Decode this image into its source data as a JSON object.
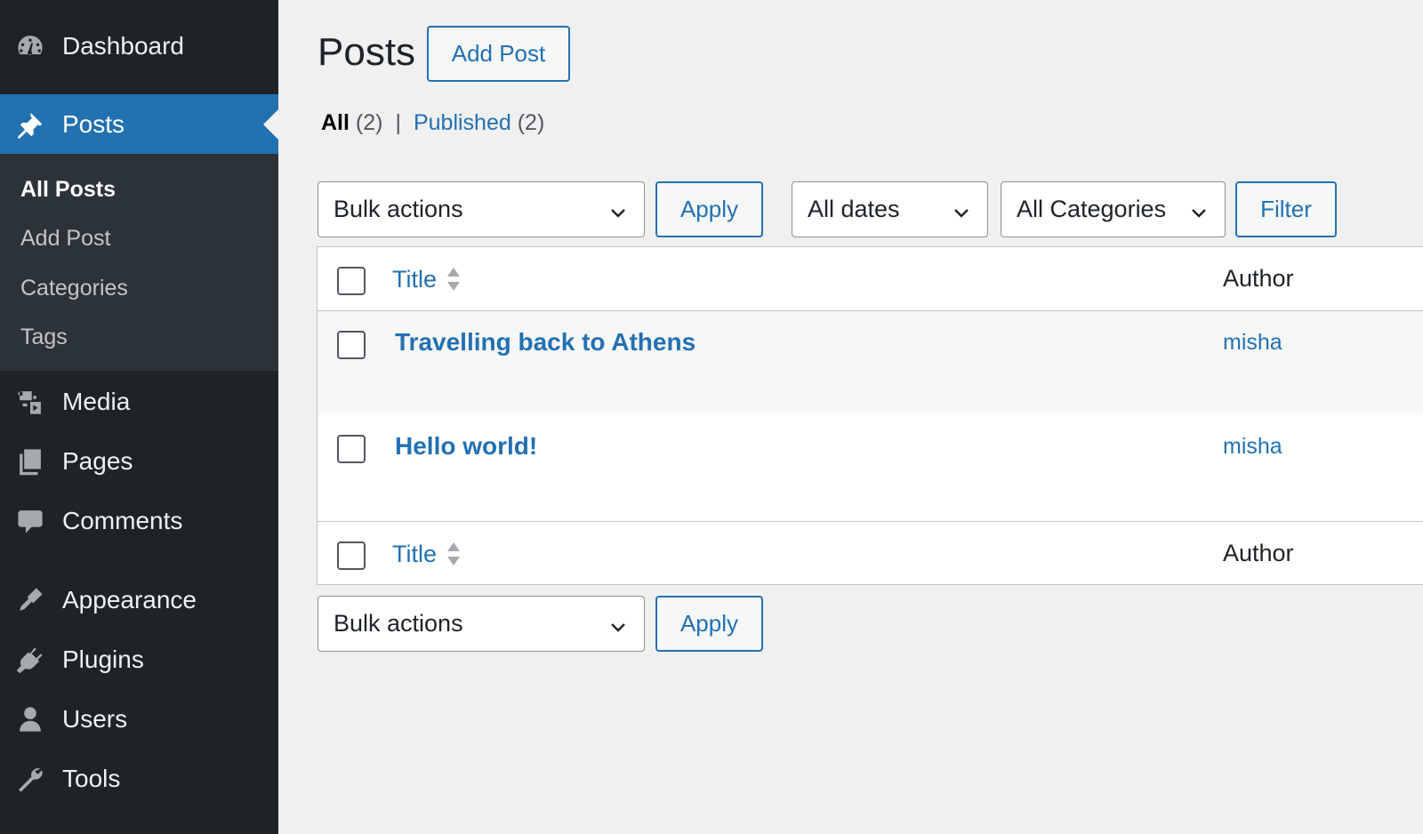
{
  "sidebar": {
    "menu": [
      {
        "label": "Dashboard",
        "icon": "dashboard-icon"
      },
      {
        "label": "Posts",
        "icon": "pushpin-icon"
      },
      {
        "label": "Media",
        "icon": "media-icon"
      },
      {
        "label": "Pages",
        "icon": "pages-icon"
      },
      {
        "label": "Comments",
        "icon": "comment-bubble-icon"
      },
      {
        "label": "Appearance",
        "icon": "paintbrush-icon"
      },
      {
        "label": "Plugins",
        "icon": "plug-icon"
      },
      {
        "label": "Users",
        "icon": "user-icon"
      },
      {
        "label": "Tools",
        "icon": "wrench-icon"
      }
    ],
    "posts_submenu": [
      "All Posts",
      "Add Post",
      "Categories",
      "Tags"
    ]
  },
  "header": {
    "title": "Posts",
    "add_button": "Add Post"
  },
  "views": {
    "all_label": "All",
    "all_count": "(2)",
    "separator": "|",
    "published_label": "Published",
    "published_count": "(2)"
  },
  "filters": {
    "bulk_actions": "Bulk actions",
    "apply": "Apply",
    "dates": "All dates",
    "categories": "All Categories",
    "filter": "Filter"
  },
  "table": {
    "columns": {
      "title": "Title",
      "author": "Author"
    },
    "rows": [
      {
        "title": "Travelling back to Athens",
        "author": "misha"
      },
      {
        "title": "Hello world!",
        "author": "misha"
      }
    ]
  },
  "colors": {
    "sidebar_bg": "#1d2327",
    "submenu_bg": "#2c3338",
    "accent": "#2271b1",
    "page_bg": "#f0f0f1"
  }
}
